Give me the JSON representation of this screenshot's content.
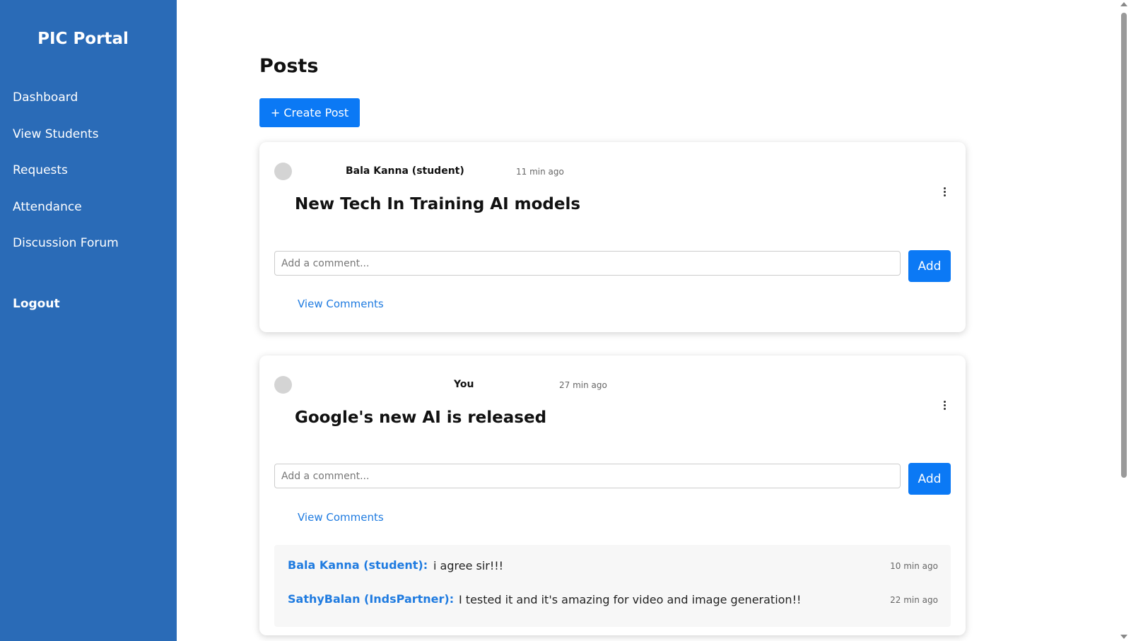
{
  "sidebar": {
    "brand": "PIC Portal",
    "items": [
      {
        "label": "Dashboard"
      },
      {
        "label": "View Students"
      },
      {
        "label": "Requests"
      },
      {
        "label": "Attendance"
      },
      {
        "label": "Discussion Forum"
      }
    ],
    "logout": "Logout"
  },
  "main": {
    "title": "Posts",
    "create_button": "+ Create Post",
    "posts": [
      {
        "author": "Bala Kanna (student)",
        "time": "11 min ago",
        "title": "New Tech In Training AI models",
        "comment_placeholder": "Add a comment...",
        "add_label": "Add",
        "view_comments": "View Comments"
      },
      {
        "author": "You",
        "time": "27 min ago",
        "title": "Google's new AI is released",
        "comment_placeholder": "Add a comment...",
        "add_label": "Add",
        "view_comments": "View Comments",
        "comments": [
          {
            "author": "Bala Kanna (student):",
            "text": "i agree sir!!!",
            "time": "10 min ago"
          },
          {
            "author": "SathyBalan (IndsPartner):",
            "text": "I tested it and it's amazing for video and image generation!!",
            "time": "22 min ago"
          }
        ]
      }
    ]
  },
  "colors": {
    "sidebar": "#2a6bb7",
    "primary_button": "#0b79f5",
    "link": "#1f7be0"
  }
}
